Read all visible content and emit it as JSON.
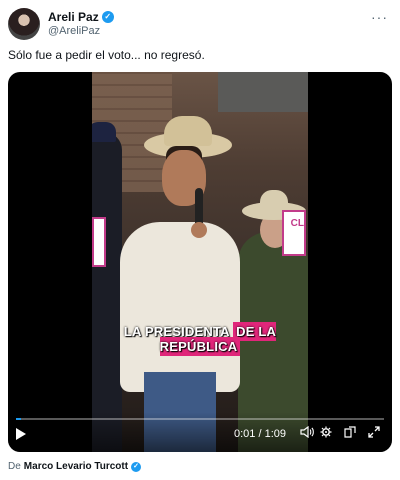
{
  "author": {
    "name": "Areli Paz",
    "handle": "@AreliPaz",
    "verified_mark": "✓"
  },
  "menu": {
    "more_glyph": "···"
  },
  "tweet": {
    "text": "Sólo fue a pedir el voto... no regresó."
  },
  "video": {
    "caption_part1": "LA PRESIDENTA ",
    "caption_part2": "DE LA REPÚBLICA",
    "sign_text": "CL",
    "time": "0:01 / 1:09",
    "progress": 0.014,
    "icons": {
      "play": "play-icon",
      "volume": "volume-icon",
      "settings": "settings-icon",
      "popout": "popout-icon",
      "fullscreen": "fullscreen-icon"
    },
    "accent": "#1d9bf0",
    "caption_highlight": "#e0267a"
  },
  "source": {
    "prefix": "De",
    "name": "Marco Levario Turcott",
    "verified_mark": "✓"
  }
}
